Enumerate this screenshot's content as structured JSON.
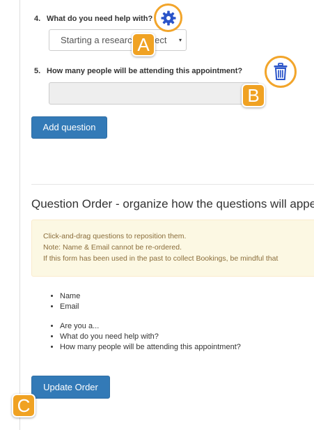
{
  "questions": [
    {
      "number": "4.",
      "label": "What do you need help with?",
      "select_value": "Starting a research project",
      "caret": "▾"
    },
    {
      "number": "5.",
      "label": "How many people will be attending this appointment?"
    }
  ],
  "buttons": {
    "add_question": "Add question",
    "update_order": "Update Order"
  },
  "question_order": {
    "title_bold": "Question Order",
    "title_rest": " - organize how the questions will appear",
    "alert_lines": [
      "Click-and-drag questions to reposition them.",
      "Note: Name & Email cannot be re-ordered.",
      "If this form has been used in the past to collect Bookings, be mindful that"
    ],
    "fixed_items": [
      "Name",
      "Email"
    ],
    "order_items": [
      "Are you a...",
      "What do you need help with?",
      "How many people will be attending this appointment?"
    ]
  },
  "callouts": {
    "a": "A",
    "b": "B",
    "c": "C"
  },
  "icons": {
    "gear": "gear-icon",
    "trash": "trash-icon"
  },
  "colors": {
    "primary": "#337ab7",
    "callout": "#f0a223",
    "gear": "#2a54c9",
    "trash": "#2a54c9",
    "alert_bg": "#fcf8e3",
    "alert_text": "#8a6d3b"
  }
}
